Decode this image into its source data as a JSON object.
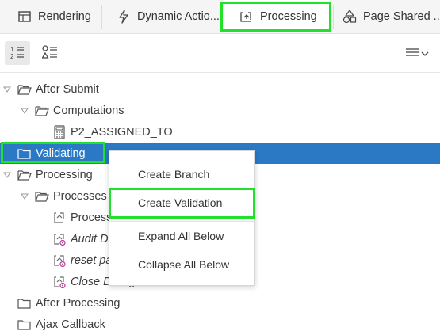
{
  "tabs": [
    {
      "label": "Rendering",
      "icon": "table-icon"
    },
    {
      "label": "Dynamic Actio...",
      "icon": "lightning-icon"
    },
    {
      "label": "Processing",
      "icon": "processing-icon"
    },
    {
      "label": "Page Shared ...",
      "icon": "shapes-icon"
    }
  ],
  "tree": {
    "items": [
      {
        "label": "After Submit"
      },
      {
        "label": "Computations"
      },
      {
        "label": "P2_ASSIGNED_TO"
      },
      {
        "label": "Validating"
      },
      {
        "label": "Processing"
      },
      {
        "label": "Processes"
      },
      {
        "label": "Process"
      },
      {
        "label": "Audit De"
      },
      {
        "label": "reset pa"
      },
      {
        "label": "Close Dialog"
      },
      {
        "label": "After Processing"
      },
      {
        "label": "Ajax Callback"
      }
    ]
  },
  "context_menu": {
    "items": [
      {
        "label": "Create Branch"
      },
      {
        "label": "Create Validation"
      },
      {
        "label": "Expand All Below"
      },
      {
        "label": "Collapse All Below"
      }
    ]
  },
  "colors": {
    "selection": "#2b78c5",
    "highlight": "#22e12a"
  }
}
